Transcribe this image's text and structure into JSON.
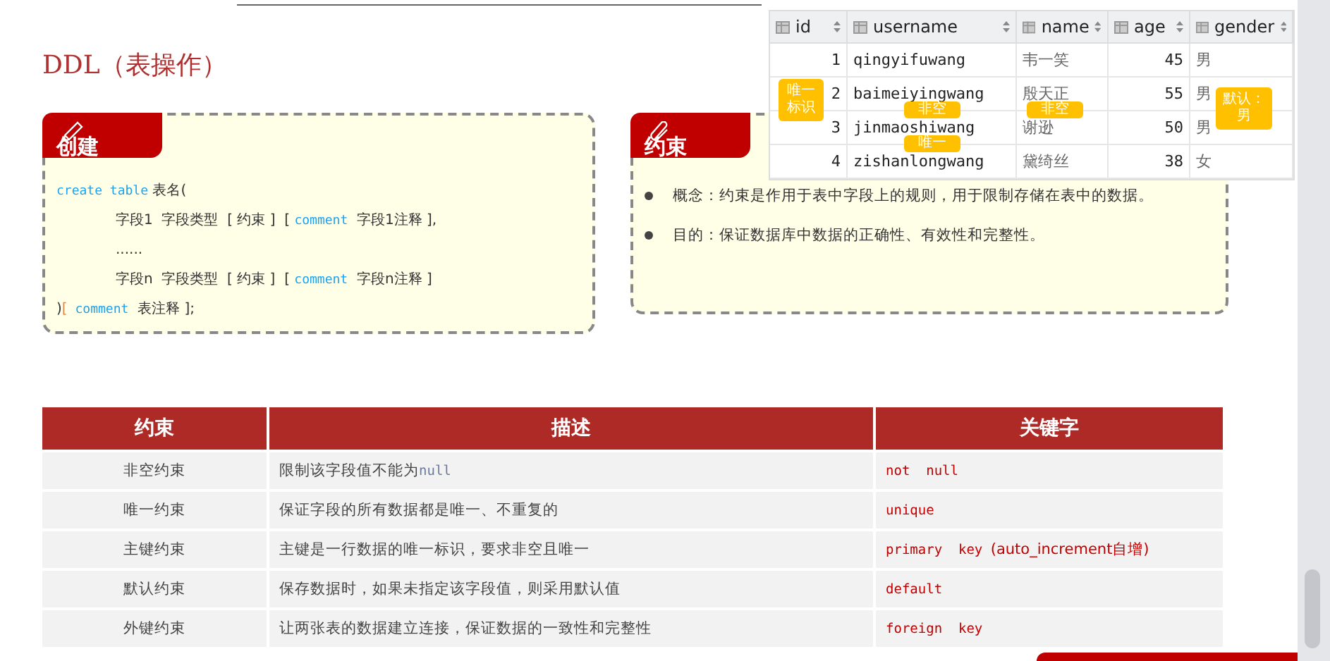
{
  "title": "DDL（表操作）",
  "create_card": {
    "tab": "创建",
    "code_lines": [
      {
        "indented": false,
        "tokens": [
          {
            "kind": "keyword",
            "text": "create table"
          },
          {
            "kind": "text",
            "text": " 表名("
          }
        ]
      },
      {
        "indented": true,
        "tokens": [
          {
            "kind": "text",
            "text": "字段1  字段类型  [ 约束 ]  [ "
          },
          {
            "kind": "keyword",
            "text": "comment"
          },
          {
            "kind": "text",
            "text": "  字段1注释 ],"
          }
        ]
      },
      {
        "indented": true,
        "tokens": [
          {
            "kind": "text",
            "text": "......"
          }
        ]
      },
      {
        "indented": true,
        "tokens": [
          {
            "kind": "text",
            "text": "字段n  字段类型  [ 约束 ]  [ "
          },
          {
            "kind": "keyword",
            "text": "comment"
          },
          {
            "kind": "text",
            "text": "  字段n注释 ]"
          }
        ]
      },
      {
        "indented": false,
        "tokens": [
          {
            "kind": "text",
            "text": ")"
          },
          {
            "kind": "punct",
            "text": "["
          },
          {
            "kind": "keyword",
            "text": " comment"
          },
          {
            "kind": "text",
            "text": "  表注释 ];"
          }
        ]
      }
    ]
  },
  "constraint_card": {
    "tab": "约束",
    "bullets": [
      "概念：约束是作用于表中字段上的规则，用于限制存储在表中的数据。",
      "目的：保证数据库中数据的正确性、有效性和完整性。"
    ]
  },
  "db_grid": {
    "columns": [
      "id",
      "username",
      "name",
      "age",
      "gender"
    ],
    "rows": [
      [
        "1",
        "qingyifuwang",
        "韦一笑",
        "45",
        "男"
      ],
      [
        "2",
        "baimeiyingwang",
        "殷天正",
        "55",
        "男"
      ],
      [
        "3",
        "jinmaoshiwang",
        "谢逊",
        "50",
        "男"
      ],
      [
        "4",
        "zishanlongwang",
        "黛绮丝",
        "38",
        "女"
      ]
    ]
  },
  "callouts": [
    {
      "text": "唯一标识"
    },
    {
      "text": "非空"
    },
    {
      "text": "非空"
    },
    {
      "text": "默认：男"
    },
    {
      "text": "唯一"
    }
  ],
  "table": {
    "columns": [
      "约束",
      "描述",
      "关键字"
    ],
    "rows": [
      {
        "constraint": "非空约束",
        "description": [
          {
            "kind": "text",
            "text": "限制该字段值不能为"
          },
          {
            "kind": "code",
            "text": "null"
          }
        ],
        "keyword": [
          {
            "kind": "code",
            "text": "not  null"
          }
        ]
      },
      {
        "constraint": "唯一约束",
        "description": [
          {
            "kind": "text",
            "text": "保证字段的所有数据都是唯一、不重复的"
          }
        ],
        "keyword": [
          {
            "kind": "code",
            "text": "unique"
          }
        ]
      },
      {
        "constraint": "主键约束",
        "description": [
          {
            "kind": "text",
            "text": "主键是一行数据的唯一标识，要求非空且唯一"
          }
        ],
        "keyword": [
          {
            "kind": "code",
            "text": "primary  key "
          },
          {
            "kind": "text",
            "text": "(auto_increment自增)"
          }
        ]
      },
      {
        "constraint": "默认约束",
        "description": [
          {
            "kind": "text",
            "text": "保存数据时，如果未指定该字段值，则采用默认值"
          }
        ],
        "keyword": [
          {
            "kind": "code",
            "text": "default"
          }
        ]
      },
      {
        "constraint": "外键约束",
        "description": [
          {
            "kind": "text",
            "text": "让两张表的数据建立连接，保证数据的一致性和完整性"
          }
        ],
        "keyword": [
          {
            "kind": "code",
            "text": "foreign  key"
          }
        ]
      }
    ]
  }
}
